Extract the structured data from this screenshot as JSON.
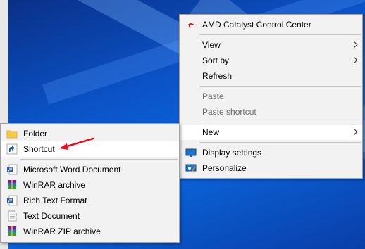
{
  "context_menu": {
    "items": [
      {
        "label": "AMD Catalyst Control Center",
        "icon": "amd-icon"
      },
      {
        "label": "View",
        "icon": ""
      },
      {
        "label": "Sort by",
        "icon": ""
      },
      {
        "label": "Refresh",
        "icon": ""
      },
      {
        "label": "Paste",
        "icon": "",
        "disabled": true
      },
      {
        "label": "Paste shortcut",
        "icon": "",
        "disabled": true
      },
      {
        "label": "New",
        "icon": ""
      },
      {
        "label": "Display settings",
        "icon": "display-icon"
      },
      {
        "label": "Personalize",
        "icon": "personalize-icon"
      }
    ]
  },
  "new_submenu": {
    "items": [
      {
        "label": "Folder",
        "icon": "folder-icon"
      },
      {
        "label": "Shortcut",
        "icon": "shortcut-icon"
      },
      {
        "label": "Microsoft Word Document",
        "icon": "word-icon"
      },
      {
        "label": "WinRAR archive",
        "icon": "winrar-icon"
      },
      {
        "label": "Rich Text Format",
        "icon": "rtf-icon"
      },
      {
        "label": "Text Document",
        "icon": "text-document-icon"
      },
      {
        "label": "WinRAR ZIP archive",
        "icon": "winrar-zip-icon"
      }
    ]
  },
  "colors": {
    "desktop_blue": "#0b52c6",
    "menu_bg": "#f2f2f2",
    "arrow_red": "#e81123"
  }
}
